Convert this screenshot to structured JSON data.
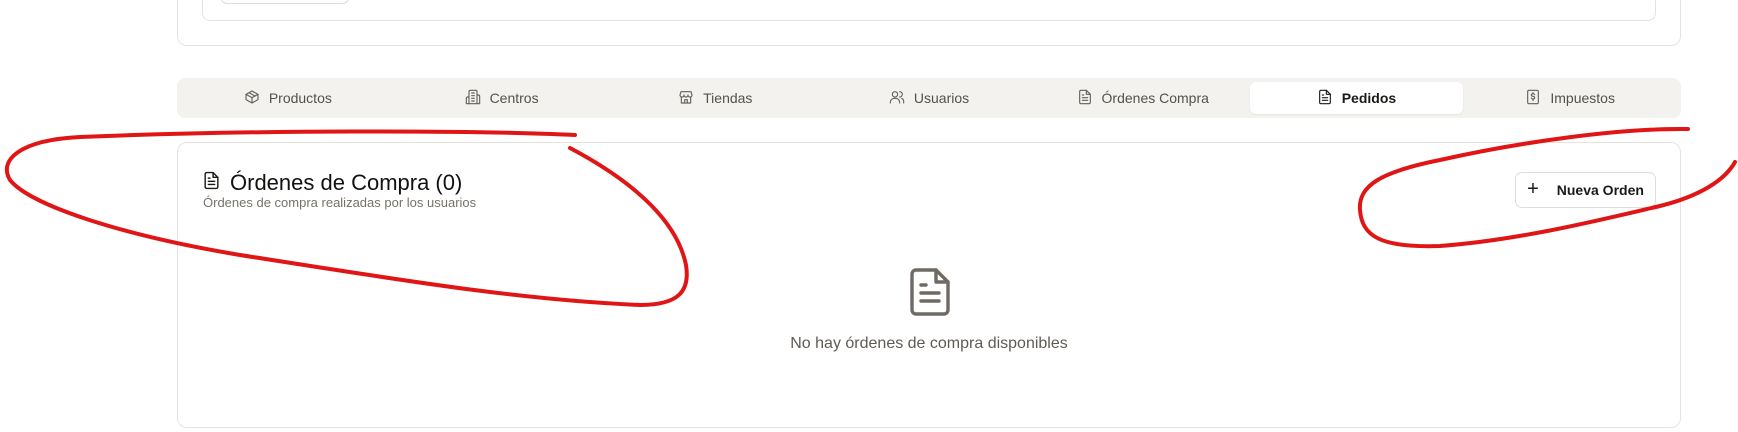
{
  "tabs": [
    {
      "label": "Productos",
      "icon": "package-icon",
      "active": false
    },
    {
      "label": "Centros",
      "icon": "building-icon",
      "active": false
    },
    {
      "label": "Tiendas",
      "icon": "store-icon",
      "active": false
    },
    {
      "label": "Usuarios",
      "icon": "users-icon",
      "active": false
    },
    {
      "label": "Órdenes Compra",
      "icon": "file-text-icon",
      "active": false
    },
    {
      "label": "Pedidos",
      "icon": "file-text-icon",
      "active": true
    },
    {
      "label": "Impuestos",
      "icon": "receipt-icon",
      "active": false
    }
  ],
  "card": {
    "title": "Órdenes de Compra (0)",
    "subtitle": "Órdenes de compra realizadas por los usuarios",
    "new_button_label": "Nueva Orden",
    "new_button_icon": "plus-icon",
    "empty_icon": "file-text-icon",
    "empty_message": "No hay órdenes de compra disponibles"
  },
  "colors": {
    "annotation": "#e01515",
    "tabs_background": "#f3f2ef",
    "active_tab": "#ffffff"
  }
}
